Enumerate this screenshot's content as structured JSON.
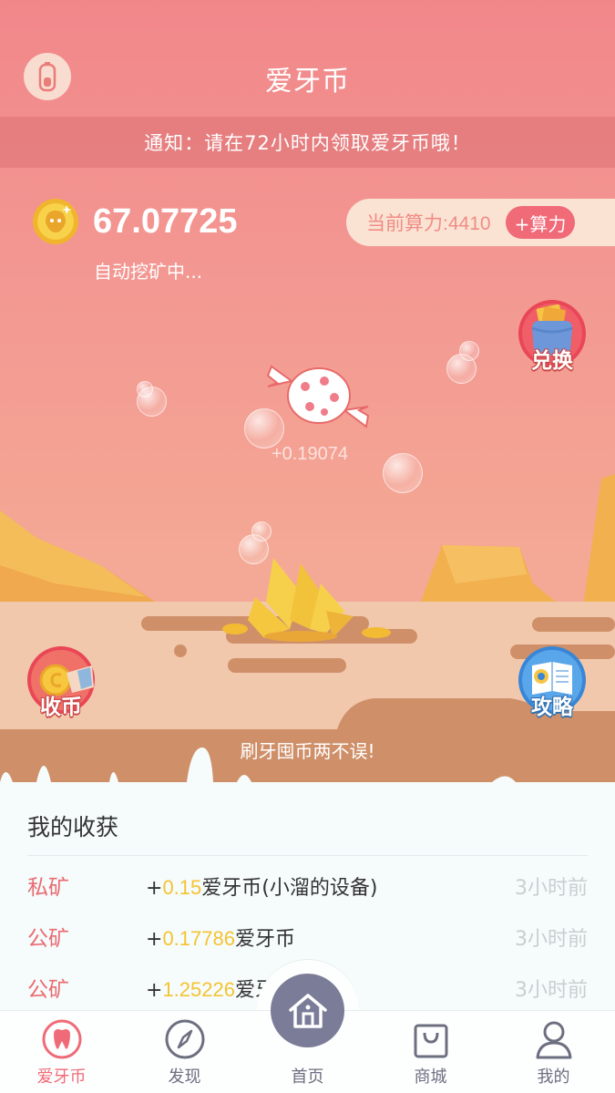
{
  "header": {
    "title": "爱牙币",
    "notice": "通知：请在72小时内领取爱牙币哦！"
  },
  "wallet": {
    "balance": "67.07725",
    "status": "自动挖矿中..."
  },
  "power": {
    "label": "当前算力:4410",
    "add_label": "+算力"
  },
  "actions": {
    "exchange": "兑换",
    "collect": "收币",
    "guide": "攻略"
  },
  "candy": {
    "amount": "+0.19074"
  },
  "slogan": "刷牙囤币两不误!",
  "harvest": {
    "title": "我的收获",
    "rows": [
      {
        "type": "私矿",
        "plus": "+",
        "amount": "0.15",
        "unit": "爱牙币(小溜的设备)",
        "time": "3小时前"
      },
      {
        "type": "公矿",
        "plus": "+",
        "amount": "0.17786",
        "unit": "爱牙币",
        "time": "3小时前"
      },
      {
        "type": "公矿",
        "plus": "+",
        "amount": "1.25226",
        "unit": "爱牙币",
        "time": "3小时前"
      }
    ]
  },
  "tabs": [
    {
      "label": "爱牙币",
      "icon": "tooth-icon",
      "active": true
    },
    {
      "label": "发现",
      "icon": "compass-icon",
      "active": false
    },
    {
      "label": "首页",
      "icon": "home-icon",
      "active": false
    },
    {
      "label": "商城",
      "icon": "shopping-bag-icon",
      "active": false
    },
    {
      "label": "我的",
      "icon": "user-icon",
      "active": false
    }
  ],
  "colors": {
    "accent": "#ef6b78",
    "coin": "#f4c431",
    "sky": "#f2878a",
    "sand": "#f2c8ad",
    "mud": "#cf9069"
  }
}
